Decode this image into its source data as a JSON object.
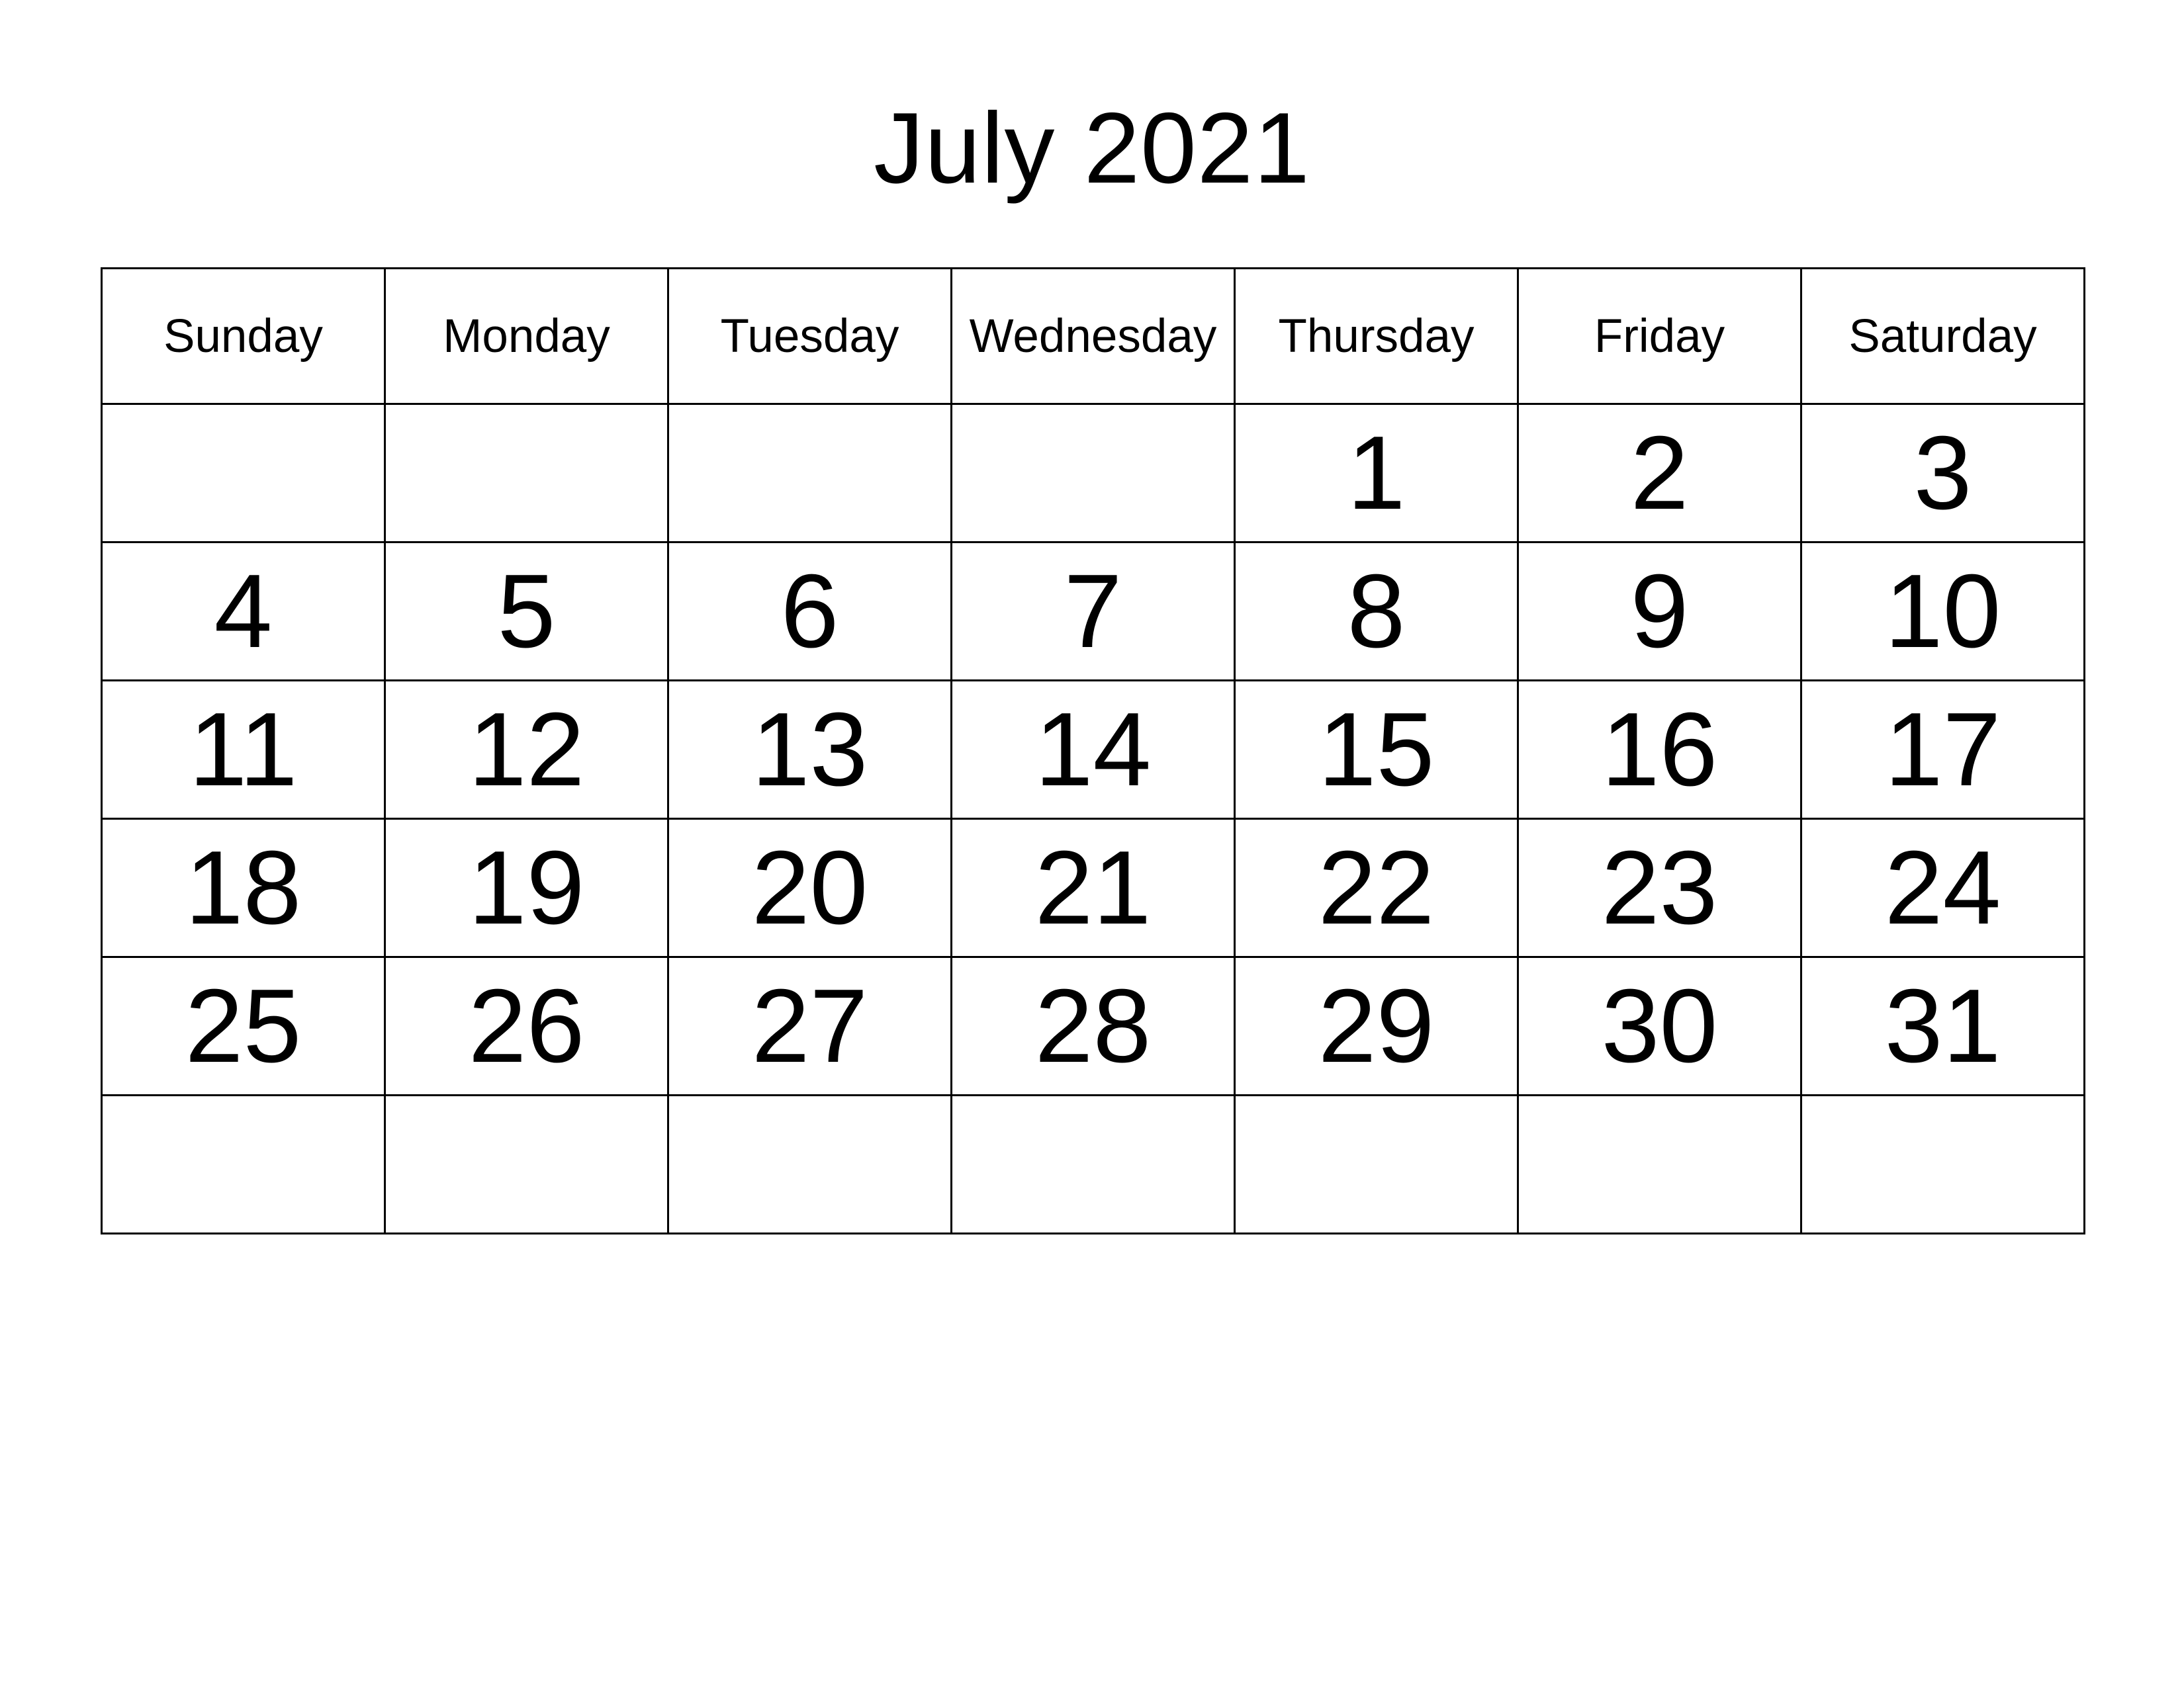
{
  "calendar": {
    "title": "July 2021",
    "month": "July",
    "year": "2021",
    "weekday_headers": [
      "Sunday",
      "Monday",
      "Tuesday",
      "Wednesday",
      "Thursday",
      "Friday",
      "Saturday"
    ],
    "weeks": [
      [
        "",
        "",
        "",
        "",
        "1",
        "2",
        "3"
      ],
      [
        "4",
        "5",
        "6",
        "7",
        "8",
        "9",
        "10"
      ],
      [
        "11",
        "12",
        "13",
        "14",
        "15",
        "16",
        "17"
      ],
      [
        "18",
        "19",
        "20",
        "21",
        "22",
        "23",
        "24"
      ],
      [
        "25",
        "26",
        "27",
        "28",
        "29",
        "30",
        "31"
      ],
      [
        "",
        "",
        "",
        "",
        "",
        "",
        ""
      ]
    ],
    "colors": {
      "background": "#ffffff",
      "text": "#000000",
      "grid_line": "#000000"
    }
  }
}
